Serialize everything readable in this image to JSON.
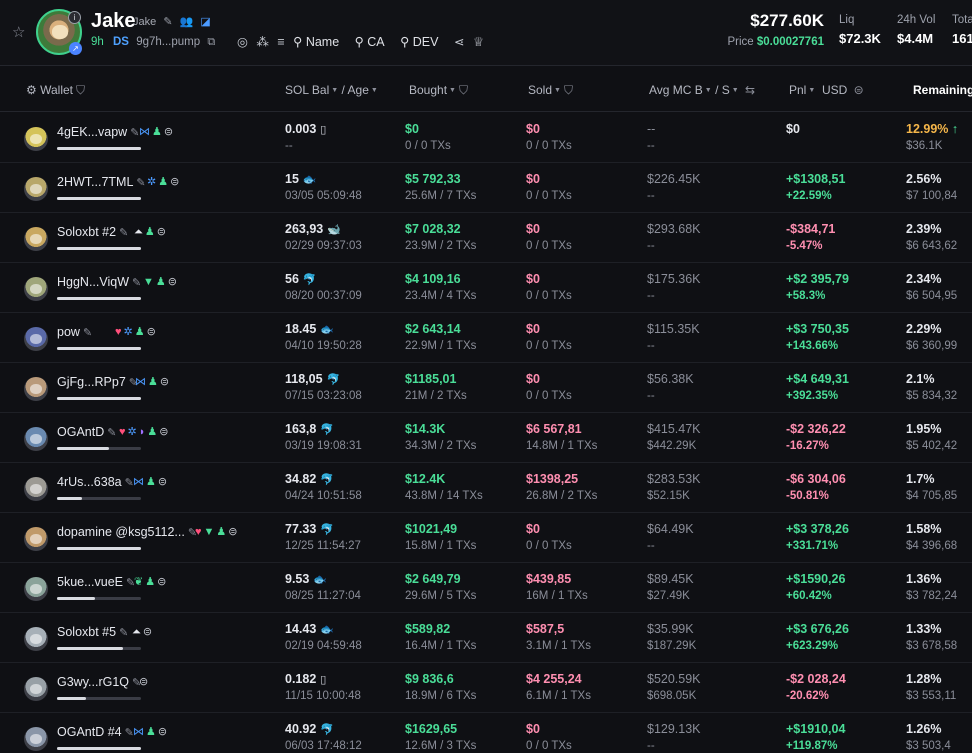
{
  "header": {
    "token_name": "Jake",
    "token_symbol": "Jake",
    "age": "9h",
    "ds_label": "DS",
    "address": "9g7h...pump",
    "toolbar": [
      "Name",
      "CA",
      "DEV"
    ],
    "market_cap": "$277.60K",
    "price_label": "Price",
    "price": "$0.00027761",
    "stats": [
      {
        "label": "Liq",
        "value": "$72.3K"
      },
      {
        "label": "24h Vol",
        "value": "$4.4M"
      },
      {
        "label": "Tota",
        "value": "161"
      }
    ]
  },
  "columns": {
    "wallet": "Wallet",
    "sol_bal": "SOL Bal",
    "age": "/ Age",
    "bought": "Bought",
    "sold": "Sold",
    "avg_mc": "Avg MC B",
    "avg_mc_s": "/ S",
    "pnl": "Pnl",
    "usd": "USD",
    "remaining": "Remaining"
  },
  "rows": [
    {
      "name": "4gEK...vapw",
      "av": "#d4c35a",
      "tags": [
        "fish",
        "user",
        "dot"
      ],
      "bar": 1.0,
      "bal": "0.003",
      "bal_icon": "▯",
      "bal_sub": "--",
      "bought": "$0",
      "bought_sub": "0 / 0 TXs",
      "sold": "$0",
      "sold_sub": "0 / 0 TXs",
      "mc_b": "--",
      "mc_s": "--",
      "pnl": "$0",
      "pnl_pct": "",
      "pnl_dir": "neutral",
      "rem": "12.99%",
      "rem_arrow": "↑",
      "rem_sub": "$36.1K",
      "rem_hl": true
    },
    {
      "name": "2HWT...7TML",
      "av": "#b8a76a",
      "tags": [
        "gear",
        "user",
        "dot"
      ],
      "bar": 1.0,
      "bal": "15",
      "bal_icon": "🐟",
      "bal_sub": "03/05 05:09:48",
      "bought": "$5 792,33",
      "bought_sub": "25.6M / 7 TXs",
      "sold": "$0",
      "sold_sub": "0 / 0 TXs",
      "mc_b": "$226.45K",
      "mc_s": "--",
      "pnl": "+$1308,51",
      "pnl_pct": "+22.59%",
      "pnl_dir": "up",
      "rem": "2.56%",
      "rem_arrow": "",
      "rem_sub": "$7 100,84",
      "rem_hl": false
    },
    {
      "name": "Soloxbt #2",
      "av": "#c9a860",
      "tags": [
        "hat",
        "user",
        "dot"
      ],
      "bar": 1.0,
      "bal": "263,93",
      "bal_icon": "🐋",
      "bal_sub": "02/29 09:37:03",
      "bought": "$7 028,32",
      "bought_sub": "23.9M / 2 TXs",
      "sold": "$0",
      "sold_sub": "0 / 0 TXs",
      "mc_b": "$293.68K",
      "mc_s": "--",
      "pnl": "-$384,71",
      "pnl_pct": "-5.47%",
      "pnl_dir": "down",
      "rem": "2.39%",
      "rem_arrow": "",
      "rem_sub": "$6 643,62",
      "rem_hl": false
    },
    {
      "name": "HggN...ViqW",
      "av": "#9fa67a",
      "tags": [
        "drop",
        "user",
        "dot"
      ],
      "bar": 1.0,
      "bal": "56",
      "bal_icon": "🐬",
      "bal_sub": "08/20 00:37:09",
      "bought": "$4 109,16",
      "bought_sub": "23.4M / 4 TXs",
      "sold": "$0",
      "sold_sub": "0 / 0 TXs",
      "mc_b": "$175.36K",
      "mc_s": "--",
      "pnl": "+$2 395,79",
      "pnl_pct": "+58.3%",
      "pnl_dir": "up",
      "rem": "2.34%",
      "rem_arrow": "",
      "rem_sub": "$6 504,95",
      "rem_hl": false
    },
    {
      "name": "pow",
      "av": "#5a6aa8",
      "tags": [
        "heart",
        "gear",
        "user",
        "dot"
      ],
      "bar": 1.0,
      "bal": "18.45",
      "bal_icon": "🐟",
      "bal_sub": "04/10 19:50:28",
      "bought": "$2 643,14",
      "bought_sub": "22.9M / 1 TXs",
      "sold": "$0",
      "sold_sub": "0 / 0 TXs",
      "mc_b": "$115.35K",
      "mc_s": "--",
      "pnl": "+$3 750,35",
      "pnl_pct": "+143.66%",
      "pnl_dir": "up",
      "rem": "2.29%",
      "rem_arrow": "",
      "rem_sub": "$6 360,99",
      "rem_hl": false
    },
    {
      "name": "GjFg...RPp7",
      "av": "#b99a7a",
      "tags": [
        "fish",
        "user",
        "dot"
      ],
      "bar": 1.0,
      "bal": "118,05",
      "bal_icon": "🐬",
      "bal_sub": "07/15 03:23:08",
      "bought": "$1185,01",
      "bought_sub": "21M / 2 TXs",
      "sold": "$0",
      "sold_sub": "0 / 0 TXs",
      "mc_b": "$56.38K",
      "mc_s": "--",
      "pnl": "+$4 649,31",
      "pnl_pct": "+392.35%",
      "pnl_dir": "up",
      "rem": "2.1%",
      "rem_arrow": "",
      "rem_sub": "$5 834,32",
      "rem_hl": false
    },
    {
      "name": "OGAntD",
      "av": "#6a8ab0",
      "tags": [
        "heart",
        "gear",
        "purple",
        "user",
        "dot"
      ],
      "bar": 0.62,
      "bal": "163,8",
      "bal_icon": "🐬",
      "bal_sub": "03/19 19:08:31",
      "bought": "$14.3K",
      "bought_sub": "34.3M / 2 TXs",
      "sold": "$6 567,81",
      "sold_sub": "14.8M / 1 TXs",
      "mc_b": "$415.47K",
      "mc_s": "$442.29K",
      "pnl": "-$2 326,22",
      "pnl_pct": "-16.27%",
      "pnl_dir": "down",
      "rem": "1.95%",
      "rem_arrow": "",
      "rem_sub": "$5 402,42",
      "rem_hl": false
    },
    {
      "name": "4rUs...638a",
      "av": "#9c9a94",
      "tags": [
        "fish",
        "user",
        "dot"
      ],
      "bar": 0.3,
      "bal": "34.82",
      "bal_icon": "🐬",
      "bal_sub": "04/24 10:51:58",
      "bought": "$12.4K",
      "bought_sub": "43.8M / 14 TXs",
      "sold": "$1398,25",
      "sold_sub": "26.8M / 2 TXs",
      "mc_b": "$283.53K",
      "mc_s": "$52.15K",
      "pnl": "-$6 304,06",
      "pnl_pct": "-50.81%",
      "pnl_dir": "down",
      "rem": "1.7%",
      "rem_arrow": "",
      "rem_sub": "$4 705,85",
      "rem_hl": false
    },
    {
      "name": "dopamine @ksg5112...",
      "av": "#c09a6a",
      "tags": [
        "heart",
        "drop",
        "user",
        "dot"
      ],
      "bar": 1.0,
      "bal": "77.33",
      "bal_icon": "🐬",
      "bal_sub": "12/25 11:54:27",
      "bought": "$1021,49",
      "bought_sub": "15.8M / 1 TXs",
      "sold": "$0",
      "sold_sub": "0 / 0 TXs",
      "mc_b": "$64.49K",
      "mc_s": "--",
      "pnl": "+$3 378,26",
      "pnl_pct": "+331.71%",
      "pnl_dir": "up",
      "rem": "1.58%",
      "rem_arrow": "",
      "rem_sub": "$4 396,68",
      "rem_hl": false
    },
    {
      "name": "5kue...vueE",
      "av": "#8aa39a",
      "tags": [
        "leaf",
        "user",
        "dot"
      ],
      "bar": 0.45,
      "bal": "9.53",
      "bal_icon": "🐟",
      "bal_sub": "08/25 11:27:04",
      "bought": "$2 649,79",
      "bought_sub": "29.6M / 5 TXs",
      "sold": "$439,85",
      "sold_sub": "16M / 1 TXs",
      "mc_b": "$89.45K",
      "mc_s": "$27.49K",
      "pnl": "+$1590,26",
      "pnl_pct": "+60.42%",
      "pnl_dir": "up",
      "rem": "1.36%",
      "rem_arrow": "",
      "rem_sub": "$3 782,24",
      "rem_hl": false
    },
    {
      "name": "Soloxbt #5",
      "av": "#a7b0b8",
      "tags": [
        "hat",
        "dot"
      ],
      "bar": 0.78,
      "bal": "14.43",
      "bal_icon": "🐟",
      "bal_sub": "02/19 04:59:48",
      "bought": "$589,82",
      "bought_sub": "16.4M / 1 TXs",
      "sold": "$587,5",
      "sold_sub": "3.1M / 1 TXs",
      "mc_b": "$35.99K",
      "mc_s": "$187.29K",
      "pnl": "+$3 676,26",
      "pnl_pct": "+623.29%",
      "pnl_dir": "up",
      "rem": "1.33%",
      "rem_arrow": "",
      "rem_sub": "$3 678,58",
      "rem_hl": false
    },
    {
      "name": "G3wy...rG1Q",
      "av": "#98a0a6",
      "tags": [
        "dot"
      ],
      "bar": 0.35,
      "bal": "0.182",
      "bal_icon": "▯",
      "bal_sub": "11/15 10:00:48",
      "bought": "$9 836,6",
      "bought_sub": "18.9M / 6 TXs",
      "sold": "$4 255,24",
      "sold_sub": "6.1M / 1 TXs",
      "mc_b": "$520.59K",
      "mc_s": "$698.05K",
      "pnl": "-$2 028,24",
      "pnl_pct": "-20.62%",
      "pnl_dir": "down",
      "rem": "1.28%",
      "rem_arrow": "",
      "rem_sub": "$3 553,11",
      "rem_hl": false
    },
    {
      "name": "OGAntD #4",
      "av": "#8a96a8",
      "tags": [
        "fish",
        "user",
        "dot"
      ],
      "bar": 1.0,
      "bal": "40.92",
      "bal_icon": "🐬",
      "bal_sub": "06/03 17:48:12",
      "bought": "$1629,65",
      "bought_sub": "12.6M / 3 TXs",
      "sold": "$0",
      "sold_sub": "0 / 0 TXs",
      "mc_b": "$129.13K",
      "mc_s": "--",
      "pnl": "+$1910,04",
      "pnl_pct": "+119.87%",
      "pnl_dir": "up",
      "rem": "1.26%",
      "rem_arrow": "",
      "rem_sub": "$3 503,4",
      "rem_hl": false
    }
  ]
}
